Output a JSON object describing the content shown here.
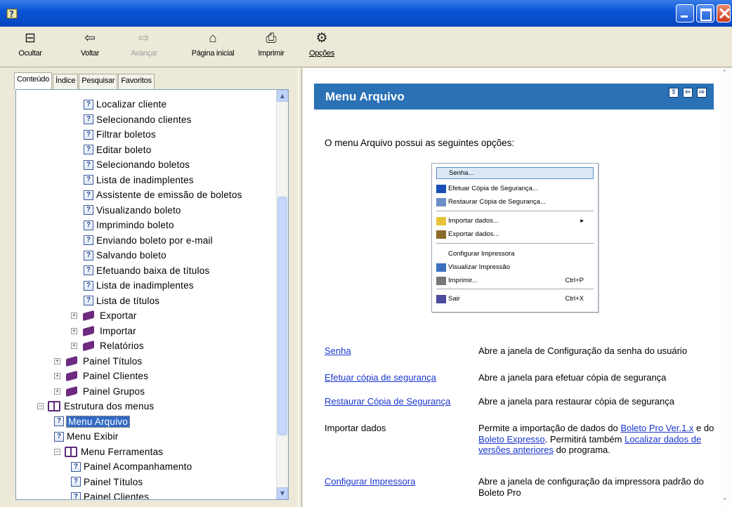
{
  "window": {
    "title": ""
  },
  "toolbar": {
    "hide": "Ocultar",
    "back": "Voltar",
    "forward": "Avançar",
    "home": "Página inicial",
    "print": "Imprimir",
    "options": "Opções"
  },
  "tabs": [
    "Conteúdo",
    "Índice",
    "Pesquisar",
    "Favoritos"
  ],
  "tree": [
    {
      "label": "Localizar cliente",
      "type": "topic",
      "level": 3
    },
    {
      "label": "Selecionando clientes",
      "type": "topic",
      "level": 3
    },
    {
      "label": "Filtrar boletos",
      "type": "topic",
      "level": 3
    },
    {
      "label": "Editar boleto",
      "type": "topic",
      "level": 3
    },
    {
      "label": "Selecionando boletos",
      "type": "topic",
      "level": 3
    },
    {
      "label": "Lista de inadimplentes",
      "type": "topic",
      "level": 3
    },
    {
      "label": "Assistente de emissão de boletos",
      "type": "topic",
      "level": 3
    },
    {
      "label": "Visualizando boleto",
      "type": "topic",
      "level": 3
    },
    {
      "label": "Imprimindo boleto",
      "type": "topic",
      "level": 3
    },
    {
      "label": "Enviando boleto por e-mail",
      "type": "topic",
      "level": 3
    },
    {
      "label": "Salvando boleto",
      "type": "topic",
      "level": 3
    },
    {
      "label": "Efetuando baixa de títulos",
      "type": "topic",
      "level": 3
    },
    {
      "label": "Lista de inadimplentes",
      "type": "topic",
      "level": 3
    },
    {
      "label": "Lista de títulos",
      "type": "topic",
      "level": 3
    },
    {
      "label": "Exportar",
      "type": "book",
      "level": 2
    },
    {
      "label": "Importar",
      "type": "book",
      "level": 2
    },
    {
      "label": "Relatórios",
      "type": "book",
      "level": 2
    },
    {
      "label": "Painel Títulos",
      "type": "book",
      "level": 1
    },
    {
      "label": "Painel Clientes",
      "type": "book",
      "level": 1
    },
    {
      "label": "Painel Grupos",
      "type": "book",
      "level": 1
    },
    {
      "label": "Estrutura dos menus",
      "type": "open",
      "level": 0
    },
    {
      "label": "Menu Arquivo",
      "type": "topic",
      "level": 1,
      "selected": true
    },
    {
      "label": "Menu Exibir",
      "type": "topic",
      "level": 1
    },
    {
      "label": "Menu Ferramentas",
      "type": "open",
      "level": 1
    },
    {
      "label": "Painel Acompanhamento",
      "type": "topic",
      "level": 2
    },
    {
      "label": "Painel Títulos",
      "type": "topic",
      "level": 2
    },
    {
      "label": "Painel Clientes",
      "type": "topic",
      "level": 2
    }
  ],
  "content": {
    "title": "Menu Arquivo",
    "intro": "O menu Arquivo possui as seguintes opções:",
    "menu": [
      {
        "label": "Senha...",
        "shortcut": "",
        "icon": "none",
        "highlight": true
      },
      {
        "label": "Efetuar Cópia de Segurança...",
        "shortcut": "",
        "icon": "save-icon"
      },
      {
        "label": "Restaurar Cópia de Segurança...",
        "shortcut": "",
        "icon": "restore-icon"
      },
      {
        "label": "Importar dados...",
        "shortcut": "▸",
        "icon": "folder-icon"
      },
      {
        "label": "Exportar dados...",
        "shortcut": "",
        "icon": "export-icon"
      },
      {
        "label": "Configurar Impressora",
        "shortcut": "",
        "icon": "none"
      },
      {
        "label": "Visualizar Impressão",
        "shortcut": "",
        "icon": "preview-icon"
      },
      {
        "label": "Imprimir...",
        "shortcut": "Ctrl+P",
        "icon": "printer-icon"
      },
      {
        "label": "Sair",
        "shortcut": "Ctrl+X",
        "icon": "exit-icon"
      }
    ],
    "rows": [
      {
        "name": "Senha",
        "link": true,
        "desc": "Abre a janela de Configuração da senha do usuário"
      },
      {
        "name": "Efetuar cópia de segurança",
        "link": true,
        "desc": "Abre a janela para efetuar cópia de segurança"
      },
      {
        "name": "Restaurar Cópia de Segurança",
        "link": true,
        "desc": "Abre a janela para restaurar cópia de segurança"
      },
      {
        "name": "Importar dados",
        "link": false,
        "desc_parts": [
          "Permite a importação de dados do ",
          "Boleto Pro Ver.1.x",
          " e do ",
          "Boleto Expresso",
          ". Permitirá também ",
          "Localizar dados de versões anteriores",
          " do programa."
        ]
      },
      {
        "name": "Configurar Impressora",
        "link": true,
        "desc": "Abre a janela de configuração da impressora padrão do Boleto Pro"
      }
    ]
  }
}
